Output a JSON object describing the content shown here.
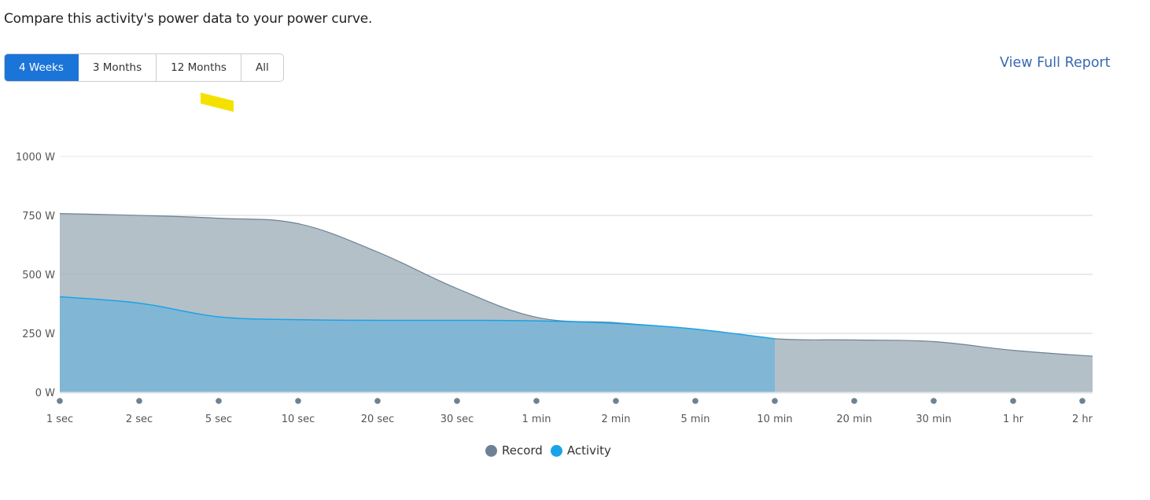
{
  "intro_text": "Compare this activity's power data to your power curve.",
  "range_buttons": [
    {
      "label": "4 Weeks",
      "active": true
    },
    {
      "label": "3 Months",
      "active": false
    },
    {
      "label": "12 Months",
      "active": false
    },
    {
      "label": "All",
      "active": false
    }
  ],
  "report_link": "View Full Report",
  "colors": {
    "accent": "#1b74d8",
    "link": "#3a68b3",
    "record": "#6c8294",
    "record_fill": "#b3c0c8",
    "activity": "#1aa3e8",
    "activity_fill": "#7eb6d6",
    "highlight": "#f5e100"
  },
  "chart_data": {
    "type": "area",
    "title": "",
    "xlabel": "",
    "ylabel": "",
    "y_unit": "W",
    "ylim": [
      0,
      1000
    ],
    "yticks": [
      0,
      250,
      500,
      750,
      1000
    ],
    "ytick_labels": [
      "0 W",
      "250 W",
      "500 W",
      "750 W",
      "1000 W"
    ],
    "categories": [
      "1 sec",
      "2 sec",
      "5 sec",
      "10 sec",
      "20 sec",
      "30 sec",
      "1 min",
      "2 min",
      "5 min",
      "10 min",
      "20 min",
      "30 min",
      "1 hr",
      "2 hr"
    ],
    "grid": true,
    "legend_position": "bottom-center",
    "series": [
      {
        "name": "Record",
        "values": [
          758,
          750,
          738,
          715,
          595,
          440,
          318,
          295,
          268,
          227,
          222,
          215,
          178,
          153
        ]
      },
      {
        "name": "Activity",
        "values": [
          405,
          378,
          320,
          308,
          305,
          305,
          303,
          292,
          268,
          227,
          null,
          null,
          null,
          null
        ]
      }
    ]
  }
}
